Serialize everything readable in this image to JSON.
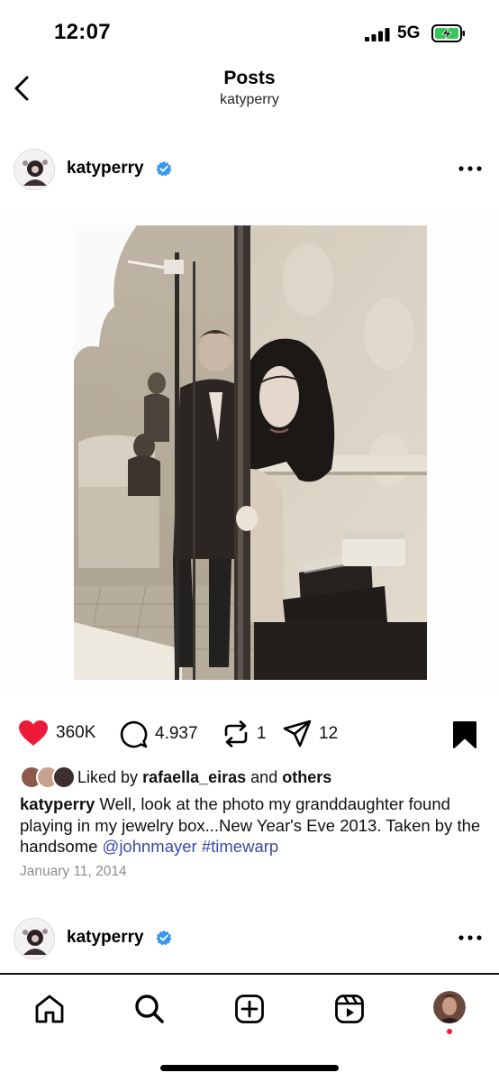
{
  "status_bar": {
    "time": "12:07",
    "network": "5G"
  },
  "header": {
    "title": "Posts",
    "subtitle": "katyperry"
  },
  "post": {
    "username": "katyperry",
    "likes_count": "360K",
    "comments_count": "4.937",
    "reposts_count": "1",
    "shares_count": "12",
    "liked_by_prefix": "Liked by",
    "liked_by_user": "rafaella_eiras",
    "liked_by_and": "and",
    "liked_by_others": "others",
    "caption_text": "Well, look at the photo my granddaughter found playing in my jewelry box...New Year's Eve 2013. Taken by the handsome",
    "caption_mention": "@johnmayer",
    "caption_hashtag": "#timewarp",
    "date": "January 11, 2014"
  },
  "next_post": {
    "username": "katyperry"
  },
  "icons": {
    "back": "chevron-left-icon",
    "verified": "verified-badge-icon",
    "more": "more-horizontal-icon",
    "like": "heart-filled-icon",
    "comment": "comment-icon",
    "repost": "repost-icon",
    "share": "paper-plane-icon",
    "save": "bookmark-filled-icon",
    "home": "home-icon",
    "search": "search-icon",
    "create": "plus-square-icon",
    "reels": "reels-icon",
    "profile": "profile-avatar"
  },
  "colors": {
    "like": "#ed1a3a",
    "verified": "#3797f0",
    "link": "#3b4aa6",
    "battery": "#34c759",
    "date": "#8e8e8e"
  }
}
